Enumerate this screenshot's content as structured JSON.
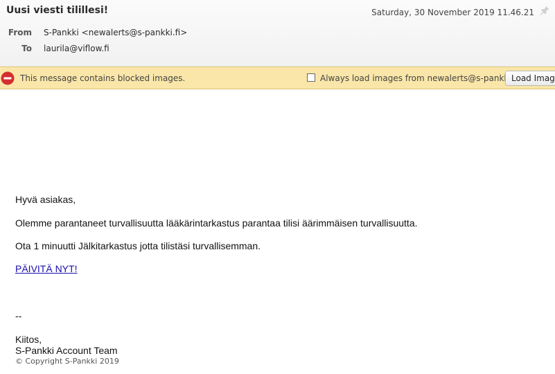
{
  "header": {
    "subject": "Uusi viesti tilillesi!",
    "date": "Saturday, 30 November 2019 11.46.21",
    "from_label": "From",
    "from_value": "S-Pankki <newalerts@s-pankki.fi>",
    "to_label": "To",
    "to_value": "laurila@viflow.fi"
  },
  "notice": {
    "text": "This message contains blocked images.",
    "always_label": "Always load images from newalerts@s-pankki.fi",
    "always_checked": false,
    "load_button": "Load Images"
  },
  "message": {
    "greeting": "Hyvä asiakas,",
    "paragraph1": "Olemme parantaneet turvallisuutta lääkärintarkastus parantaa tilisi äärimmäisen turvallisuutta.",
    "paragraph2": "Ota 1 minuutti Jälkitarkastus jotta tilistäsi turvallisemman.",
    "link_text": "PÄIVITÄ NYT!",
    "separator": "--",
    "closing": "Kiitos,",
    "signature": "S-Pankki Account Team",
    "copyright": "© Copyright S-Pankki 2019"
  },
  "colors": {
    "notice_background": "#f9e6a8",
    "blocked_icon": "#d32f2f",
    "link": "#1a0dab"
  }
}
